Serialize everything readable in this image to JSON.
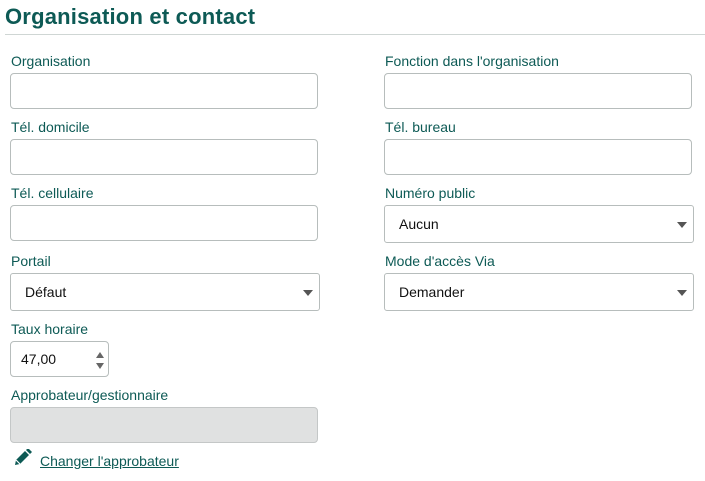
{
  "section": {
    "title": "Organisation et contact"
  },
  "fields": {
    "organisation": {
      "label": "Organisation",
      "value": ""
    },
    "fonction": {
      "label": "Fonction dans l'organisation",
      "value": ""
    },
    "tel_domicile": {
      "label": "Tél. domicile",
      "value": ""
    },
    "tel_bureau": {
      "label": "Tél. bureau",
      "value": ""
    },
    "tel_cellulaire": {
      "label": "Tél. cellulaire",
      "value": ""
    },
    "numero_public": {
      "label": "Numéro public",
      "selected": "Aucun"
    },
    "portail": {
      "label": "Portail",
      "selected": "Défaut"
    },
    "mode_acces": {
      "label": "Mode d'accès Via",
      "selected": "Demander"
    },
    "taux_horaire": {
      "label": "Taux horaire",
      "value": "47,00"
    },
    "approbateur": {
      "label": "Approbateur/gestionnaire",
      "value": ""
    }
  },
  "actions": {
    "change_approver": "Changer l'approbateur"
  },
  "icons": {
    "edit": "pencil-icon"
  },
  "colors": {
    "accent": "#0d5a55"
  }
}
